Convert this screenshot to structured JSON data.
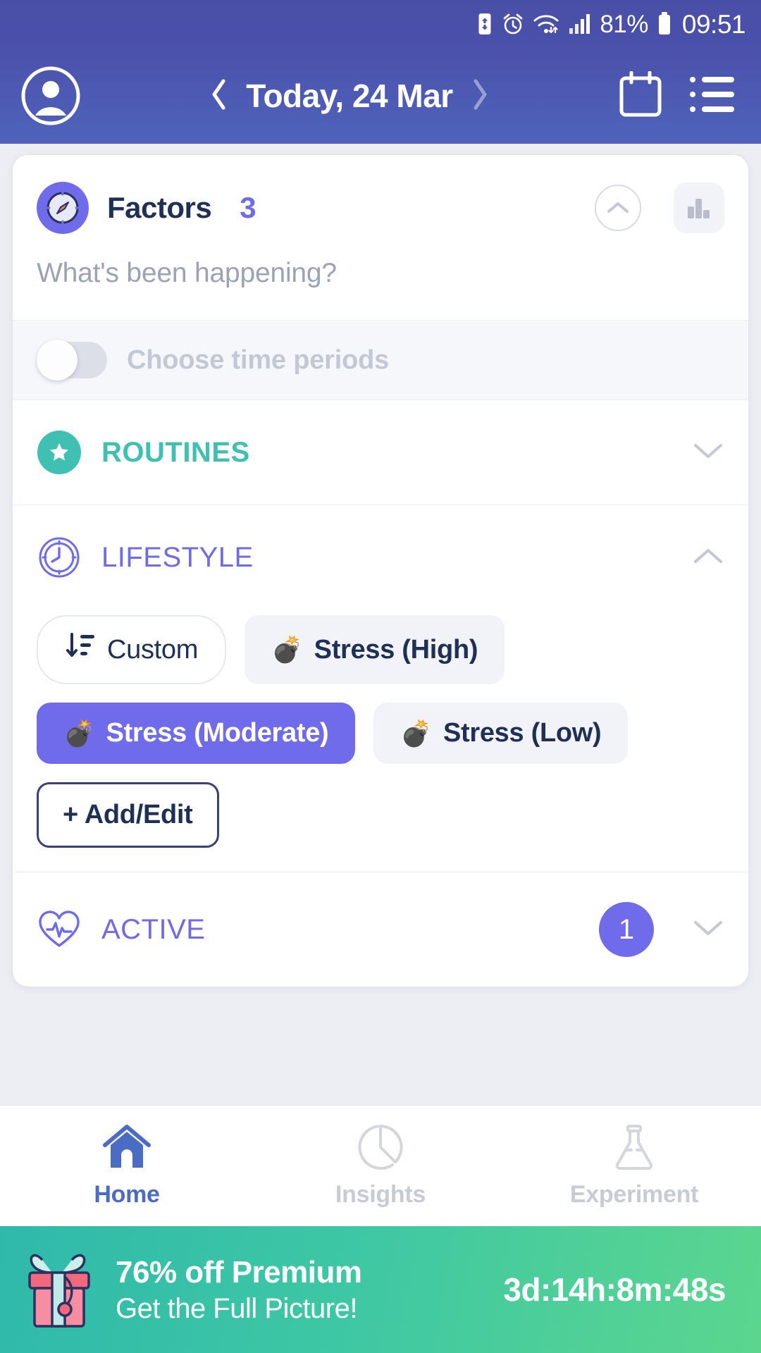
{
  "status_bar": {
    "battery_percent": "81%",
    "time": "09:51",
    "icons": [
      "battery-saver-icon",
      "alarm-icon",
      "wifi-icon",
      "signal-icon",
      "battery-icon"
    ]
  },
  "header": {
    "avatar": "account-avatar-icon",
    "prev_label": "‹",
    "date_label": "Today, 24 Mar",
    "next_label": "›",
    "calendar_icon": "calendar-icon",
    "menu_icon": "list-menu-icon"
  },
  "factors_card": {
    "icon": "compass-icon",
    "title": "Factors",
    "count": "3",
    "collapse_icon": "chevron-up-icon",
    "chart_icon": "bar-chart-icon",
    "note_placeholder": "What's been happening?",
    "time_toggle": {
      "label": "Choose time periods",
      "state": "off"
    },
    "sections": [
      {
        "id": "routines",
        "label": "ROUTINES",
        "icon": "star-icon",
        "color": "#3fc0b2",
        "expanded": false,
        "chevron": "chevron-down-icon",
        "badge": ""
      },
      {
        "id": "lifestyle",
        "label": "LIFESTYLE",
        "icon": "clock-icon",
        "color": "#6f6bea",
        "expanded": true,
        "chevron": "chevron-up-icon",
        "badge": ""
      },
      {
        "id": "active",
        "label": "ACTIVE",
        "icon": "heart-pulse-icon",
        "color": "#6f6bea",
        "expanded": false,
        "chevron": "chevron-down-icon",
        "badge": "1"
      }
    ],
    "lifestyle_chips": [
      {
        "label": "Custom",
        "emoji": "",
        "style": "outline",
        "icon": "sort-descending-icon"
      },
      {
        "label": "Stress (High)",
        "emoji": "💣",
        "style": "grey",
        "icon": "bomb-icon"
      },
      {
        "label": "Stress (Moderate)",
        "emoji": "💣",
        "style": "selected",
        "icon": "bomb-icon"
      },
      {
        "label": "Stress (Low)",
        "emoji": "💣",
        "style": "grey",
        "icon": "bomb-icon"
      }
    ],
    "add_edit_label": "+ Add/Edit"
  },
  "bottom_nav": [
    {
      "label": "Home",
      "icon": "home-icon",
      "active": true
    },
    {
      "label": "Insights",
      "icon": "pie-chart-icon",
      "active": false
    },
    {
      "label": "Experiment",
      "icon": "flask-icon",
      "active": false
    }
  ],
  "promo": {
    "icon": "gift-icon",
    "headline": "76% off Premium",
    "subline": "Get the Full Picture!",
    "countdown": "3d:14h:8m:48s"
  }
}
